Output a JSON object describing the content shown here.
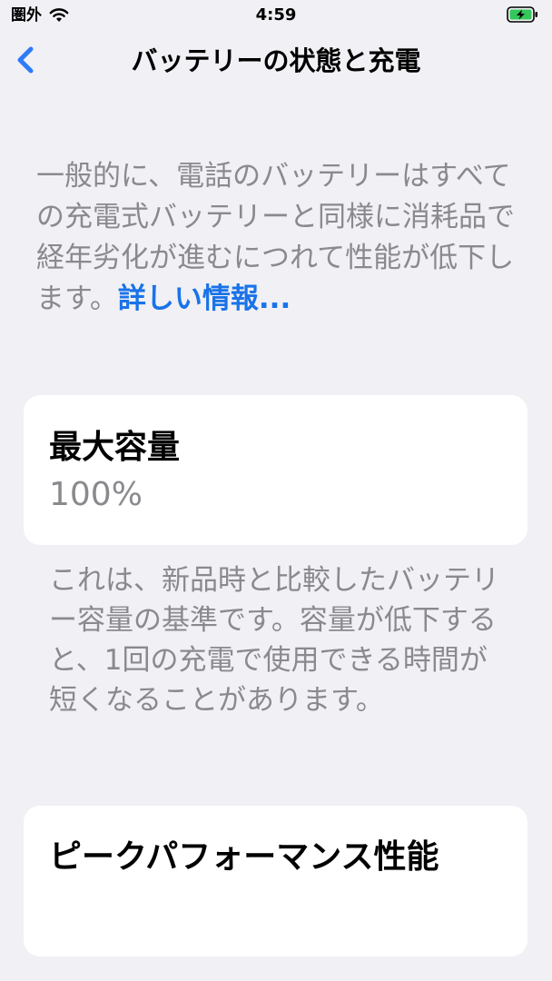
{
  "status_bar": {
    "carrier": "圏外",
    "time": "4:59",
    "icons": [
      "wifi-icon",
      "battery-charging-icon"
    ]
  },
  "nav": {
    "back_icon": "chevron-left-icon",
    "title": "バッテリーの状態と充電"
  },
  "intro": {
    "text": "一般的に、電話のバッテリーはすべての充電式バッテリーと同様に消耗品で経年劣化が進むにつれて性能が低下します。",
    "link_label": "詳しい情報..."
  },
  "capacity": {
    "title": "最大容量",
    "value": "100%",
    "footnote": "これは、新品時と比較したバッテリー容量の基準です。容量が低下すると、1回の充電で使用できる時間が短くなることがあります。"
  },
  "performance": {
    "title": "ピークパフォーマンス性能"
  },
  "colors": {
    "background": "#f0f0f5",
    "card": "#ffffff",
    "secondary_text": "#8a8a8e",
    "link": "#1a73e8",
    "accent": "#2f7cf6",
    "battery_charging": "#34c759"
  }
}
